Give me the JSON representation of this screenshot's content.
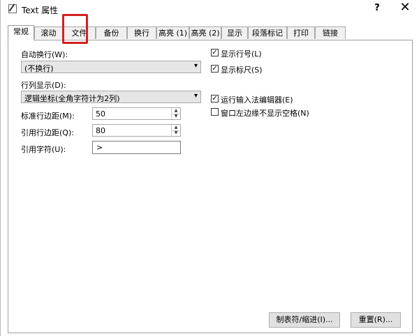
{
  "window": {
    "title": "Text 属性",
    "help_label": "?",
    "close_label": "✕",
    "app_icon": "document-pencil-icon"
  },
  "tabs": [
    {
      "label": "常规",
      "active": true
    },
    {
      "label": "滚动"
    },
    {
      "label": "文件"
    },
    {
      "label": "备份"
    },
    {
      "label": "换行"
    },
    {
      "label": "高亮 (1)"
    },
    {
      "label": "高亮 (2)"
    },
    {
      "label": "显示"
    },
    {
      "label": "段落标记"
    },
    {
      "label": "打印"
    },
    {
      "label": "链接"
    }
  ],
  "general": {
    "auto_wrap_label": "自动换行(W):",
    "auto_wrap_value": "(不换行)",
    "line_col_label": "行列显示(D):",
    "line_col_value": "逻辑坐标(全角字符计为2列)",
    "std_margin_label": "标准行边距(M):",
    "std_margin_value": "50",
    "quote_margin_label": "引用行边距(Q):",
    "quote_margin_value": "80",
    "quote_char_label": "引用字符(U):",
    "quote_char_value": ">",
    "checkboxes": [
      {
        "label": "显示行号(L)",
        "checked": true,
        "mark": "✓"
      },
      {
        "label": "显示标尺(S)",
        "checked": true,
        "mark": "✓"
      },
      {
        "label": "运行输入法编辑器(E)",
        "checked": true,
        "mark": "✓"
      },
      {
        "label": "窗口左边缘不显示空格(N)",
        "checked": false,
        "mark": ""
      }
    ]
  },
  "buttons": {
    "tab_indent": "制表符/缩进(I)...",
    "reset": "重置(R)..."
  },
  "icons": {
    "dropdown": "▾",
    "spin_up": "▲",
    "spin_down": "▼"
  },
  "colors": {
    "highlight": "#d42020"
  }
}
